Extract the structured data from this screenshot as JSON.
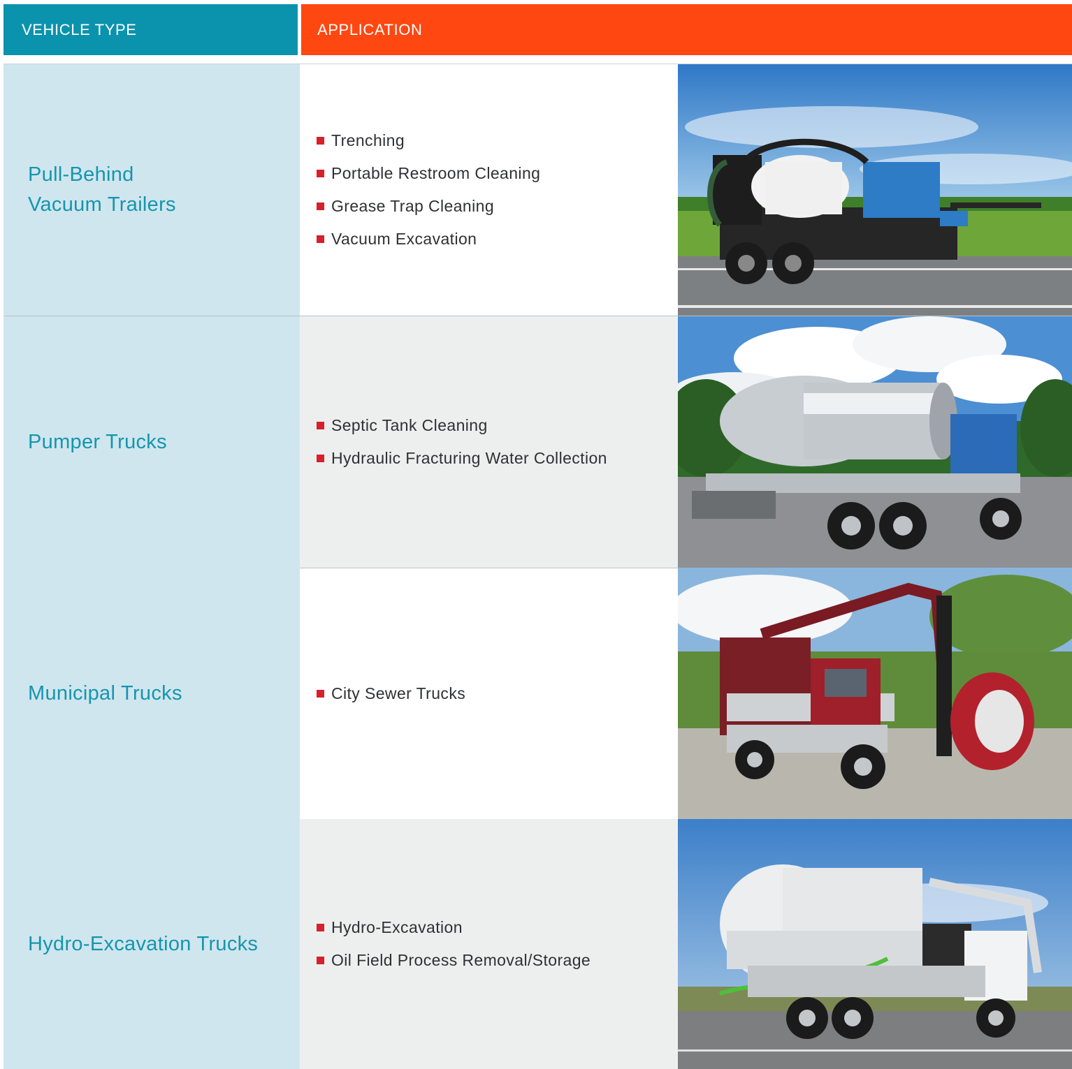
{
  "header": {
    "vehicle_type": "VEHICLE TYPE",
    "application": "APPLICATION"
  },
  "rows": [
    {
      "vehicle_type": "Pull-Behind\nVacuum Trailers",
      "applications": [
        "Trenching",
        "Portable Restroom Cleaning",
        "Grease Trap Cleaning",
        "Vacuum Excavation"
      ],
      "photo": "blue-vacuum-trailer-photo"
    },
    {
      "vehicle_type": "Pumper Trucks",
      "applications": [
        "Septic Tank Cleaning",
        "Hydraulic Fracturing Water Collection"
      ],
      "photo": "chrome-pumper-truck-photo"
    },
    {
      "vehicle_type": "Municipal Trucks",
      "applications": [
        "City Sewer Trucks"
      ],
      "photo": "red-municipal-sewer-truck-photo"
    },
    {
      "vehicle_type": "Hydro-Excavation Trucks",
      "applications": [
        "Hydro-Excavation",
        "Oil Field Process Removal/Storage"
      ],
      "photo": "white-hydro-excavation-truck-photo"
    }
  ],
  "colors": {
    "header_teal": "#0b93ad",
    "header_orange": "#fe4711",
    "type_cell_bg": "#cfe6ee",
    "type_text": "#1695ad",
    "bullet_red": "#d6202a",
    "alt_row_bg": "#edefef"
  }
}
